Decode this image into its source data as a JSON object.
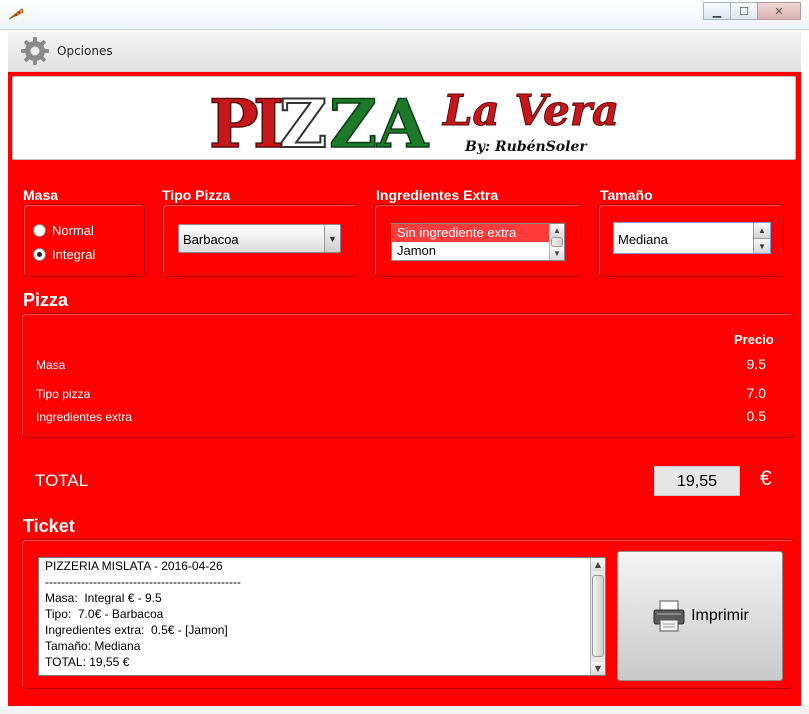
{
  "window": {
    "title": "",
    "minimize_icon": "minimize-icon",
    "maximize_icon": "maximize-icon",
    "close_icon": "close-icon"
  },
  "menu": {
    "options_label": "Opciones",
    "options_icon": "gear-icon"
  },
  "banner": {
    "title_word": "PIZZA",
    "subtitle": "La Vera",
    "byline": "By: RubénSoler"
  },
  "sections": {
    "masa": "Masa",
    "tipo_pizza": "Tipo Pizza",
    "ingredientes_extra": "Ingredientes Extra",
    "tamano": "Tamaño",
    "pizza": "Pizza",
    "ticket": "Ticket"
  },
  "masa": {
    "options": [
      {
        "label": "Normal",
        "checked": false
      },
      {
        "label": "Integral",
        "checked": true
      }
    ]
  },
  "tipo_pizza": {
    "selected": "Barbacoa"
  },
  "ingredientes": {
    "items": [
      {
        "label": "Sin ingrediente extra",
        "selected": true
      },
      {
        "label": "Jamon",
        "selected": false
      }
    ]
  },
  "tamano": {
    "value": "Mediana"
  },
  "pizza": {
    "price_header": "Precio",
    "rows": [
      {
        "label": "Masa",
        "price": "9.5"
      },
      {
        "label": "Tipo pizza",
        "price": "7.0"
      },
      {
        "label": "Ingredientes extra",
        "price": "0.5"
      }
    ]
  },
  "total": {
    "label": "TOTAL",
    "value": "19,55",
    "currency": "€"
  },
  "ticket": {
    "lines": [
      "PIZZERIA MISLATA - 2016-04-26",
      "-------------------------------------------------",
      "Masa:  Integral € - 9.5",
      "Tipo:  7.0€ - Barbacoa",
      "Ingredientes extra:  0.5€ - [Jamon]",
      "Tamaño: Mediana",
      "TOTAL: 19,55 €"
    ]
  },
  "print_button": {
    "label": "Imprimir",
    "icon": "printer-icon"
  },
  "colors": {
    "background": "#ff0000",
    "selection": "#ff3b3b",
    "logo_red": "#c8171c",
    "logo_green": "#1e7a2a"
  }
}
